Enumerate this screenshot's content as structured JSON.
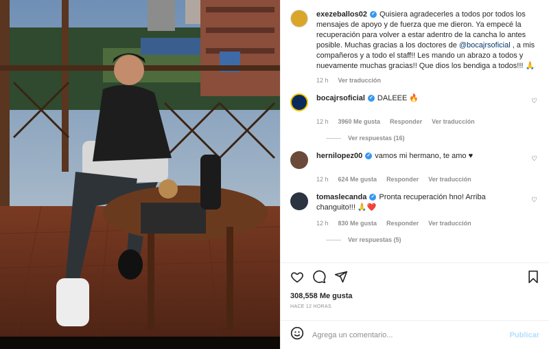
{
  "post": {
    "username": "exezeballos02",
    "caption_pre": "Quisiera agradecerles a todos por todos los mensajes de apoyo y de fuerza que me dieron. Ya empecé la recuperación para volver a estar adentro de la cancha lo antes posible. Muchas gracias a los doctores de ",
    "caption_mention": "@bocajrsoficial",
    "caption_post": " , a mis compañeros y a todo el staff!! Les mando un abrazo a todos y nuevamente muchas gracias!! Que dios los bendiga a todos!!! 🙏",
    "time": "12 h",
    "translate": "Ver traducción"
  },
  "comments": [
    {
      "username": "bocajrsoficial",
      "text": "DALEEE 🔥",
      "time": "12 h",
      "likes": "3960 Me gusta",
      "reply": "Responder",
      "translate": "Ver traducción",
      "replies": "Ver respuestas (16)"
    },
    {
      "username": "hernilopez00",
      "text": "vamos mi hermano, te amo ♥",
      "time": "12 h",
      "likes": "624 Me gusta",
      "reply": "Responder",
      "translate": "Ver traducción",
      "replies": ""
    },
    {
      "username": "tomaslecanda",
      "text": "Pronta recuperación hno! Arriba changuito!!! 🙏❤️",
      "time": "12 h",
      "likes": "830 Me gusta",
      "reply": "Responder",
      "translate": "Ver traducción",
      "replies": "Ver respuestas (5)"
    }
  ],
  "footer": {
    "likes": "308,558 Me gusta",
    "posted": "HACE 12 HORAS",
    "comment_placeholder": "Agrega un comentario...",
    "publish": "Publicar"
  },
  "icons": {
    "like": "heart-icon",
    "comment": "comment-icon",
    "share": "share-icon",
    "save": "bookmark-icon",
    "emoji": "emoji-icon"
  },
  "colors": {
    "verified": "#3897f0",
    "mention": "#00376b",
    "publish": "#b2dffc",
    "heart_red": "#ed4956"
  }
}
